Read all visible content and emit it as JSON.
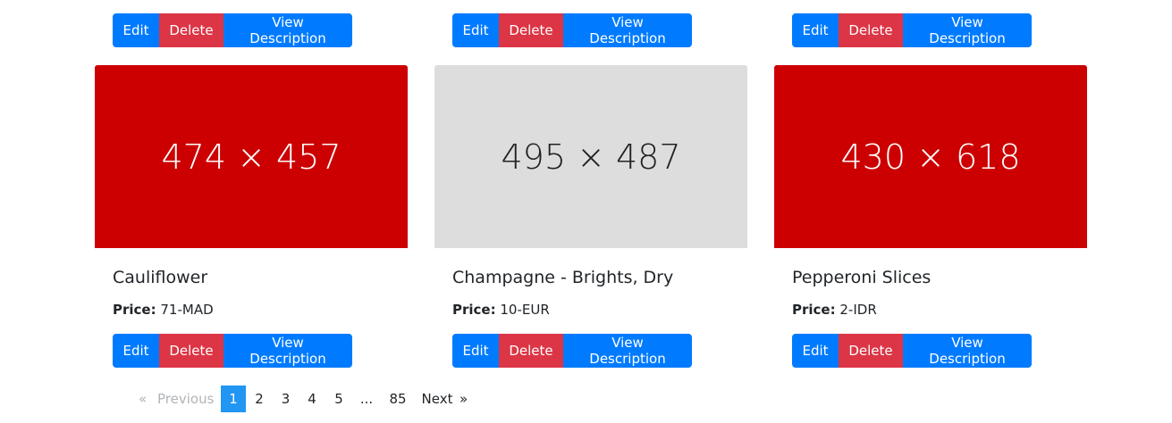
{
  "buttons": {
    "edit": "Edit",
    "delete": "Delete",
    "view": "View Description"
  },
  "cards": [
    {
      "image_text": "474 × 457",
      "image_bg": "#cc0000",
      "image_fg": "#ffffff",
      "title": "Cauliflower",
      "price_label": "Price:",
      "price_value": "71-MAD"
    },
    {
      "image_text": "495 × 487",
      "image_bg": "#dddddd",
      "image_fg": "#222222",
      "title": "Champagne - Brights, Dry",
      "price_label": "Price:",
      "price_value": "10-EUR"
    },
    {
      "image_text": "430 × 618",
      "image_bg": "#cc0000",
      "image_fg": "#ffffff",
      "title": "Pepperoni Slices",
      "price_label": "Price:",
      "price_value": "2-IDR"
    }
  ],
  "pagination": {
    "prev_arrow": "«",
    "previous": "Previous",
    "pages": [
      "1",
      "2",
      "3",
      "4",
      "5"
    ],
    "ellipsis": "...",
    "last": "85",
    "next": "Next",
    "next_arrow": "»",
    "active_page": "1"
  }
}
